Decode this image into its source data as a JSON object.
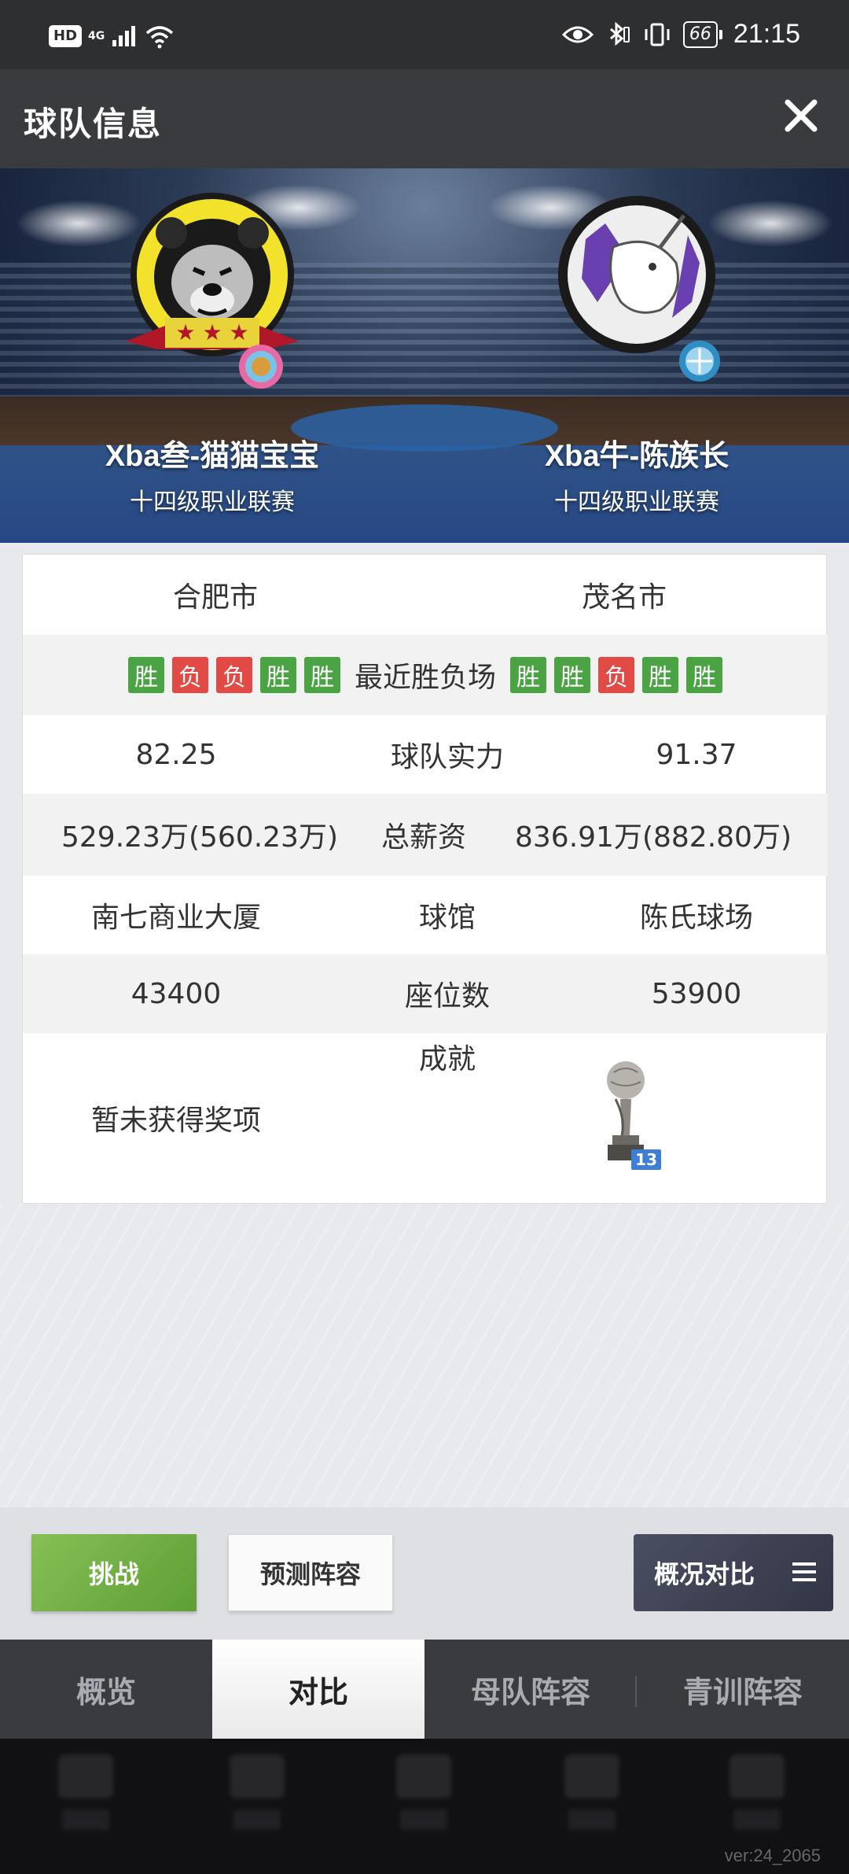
{
  "status_bar": {
    "hd": "HD",
    "network": "4G",
    "battery": "66",
    "time": "21:15"
  },
  "header": {
    "title": "球队信息"
  },
  "teams": {
    "home": {
      "name": "Xba叁-猫猫宝宝",
      "league": "十四级职业联赛"
    },
    "away": {
      "name": "Xba牛-陈族长",
      "league": "十四级职业联赛"
    }
  },
  "compare": {
    "city": {
      "home": "合肥市",
      "away": "茂名市"
    },
    "recent": {
      "label": "最近胜负场",
      "home": [
        "胜",
        "负",
        "负",
        "胜",
        "胜"
      ],
      "away": [
        "胜",
        "胜",
        "负",
        "胜",
        "胜"
      ]
    },
    "strength": {
      "label": "球队实力",
      "home": "82.25",
      "away": "91.37"
    },
    "salary": {
      "label": "总薪资",
      "home": "529.23万(560.23万)",
      "away": "836.91万(882.80万)"
    },
    "arena": {
      "label": "球馆",
      "home": "南七商业大厦",
      "away": "陈氏球场"
    },
    "seats": {
      "label": "座位数",
      "home": "43400",
      "away": "53900"
    },
    "achievements": {
      "label": "成就",
      "home": "暂未获得奖项",
      "away_trophy_count": "13"
    }
  },
  "actions": {
    "challenge": "挑战",
    "predict": "预测阵容",
    "overview": "概况对比"
  },
  "tabs": [
    "概览",
    "对比",
    "母队阵容",
    "青训阵容"
  ],
  "active_tab": "对比",
  "version": "ver:24_2065",
  "colors": {
    "win": "#4aa443",
    "loss": "#e24b45",
    "header_bg": "#3a3b3e",
    "challenge_green": "#6fb042"
  }
}
